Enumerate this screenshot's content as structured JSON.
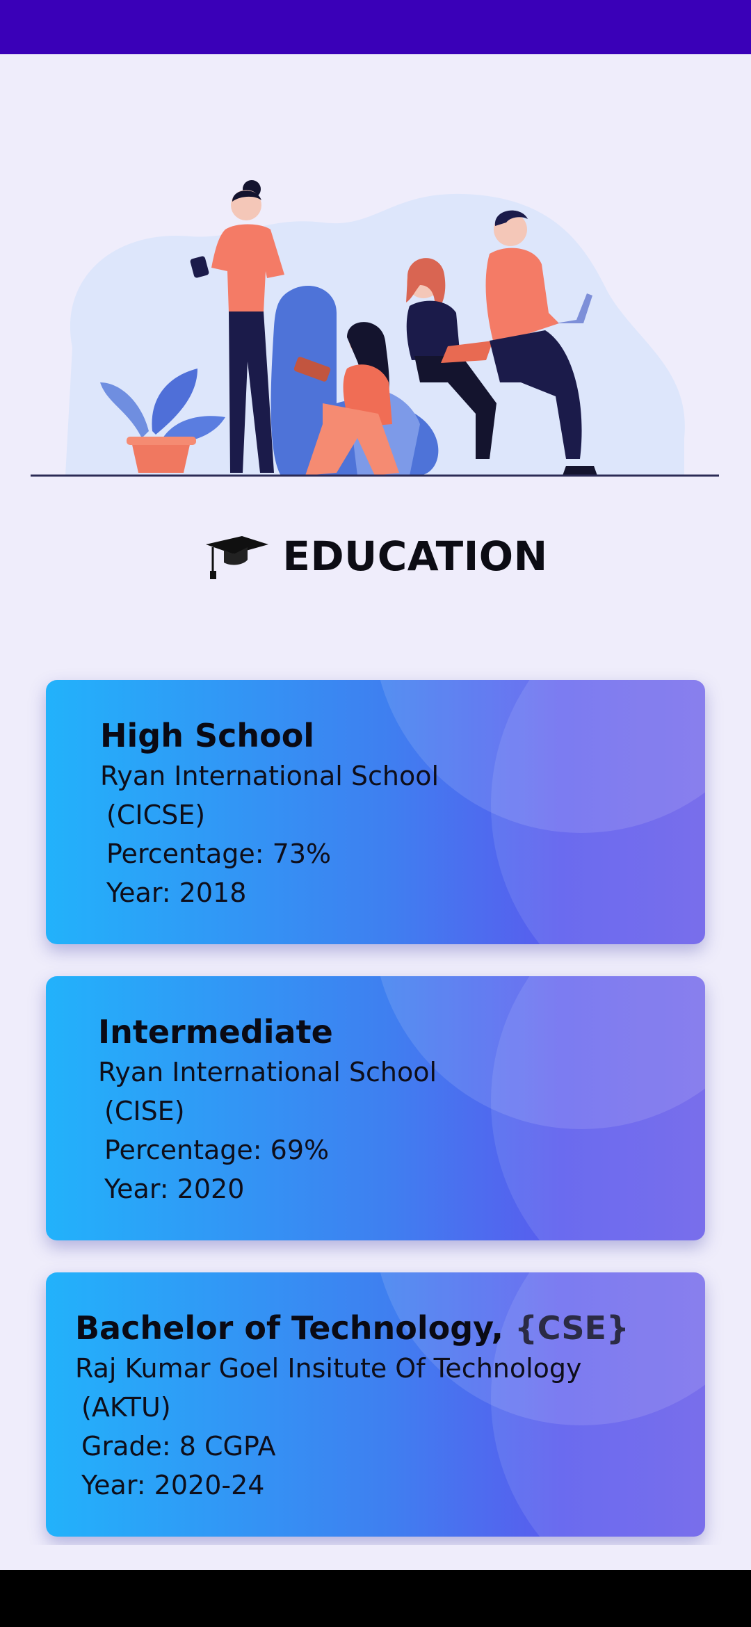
{
  "colors": {
    "status_bar": "#3a00b8",
    "page_background": "#efedfb",
    "card_gradient_start": "#22b2fb",
    "card_gradient_end": "#6a5ee9"
  },
  "hero": {
    "illustration": "people-studying-illustration"
  },
  "section": {
    "icon": "graduation-cap-icon",
    "title": "EDUCATION"
  },
  "education": [
    {
      "title": "High School",
      "institution": "Ryan International School",
      "board": "(CICSE)",
      "score": "Percentage: 73%",
      "year": "Year: 2018"
    },
    {
      "title": "Intermediate",
      "institution": "Ryan International School",
      "board": "(CISE)",
      "score": "Percentage: 69%",
      "year": "Year: 2020"
    },
    {
      "title": "Bachelor of Technology, ",
      "title_accent": "{CSE}",
      "institution": "Raj Kumar Goel Insitute Of Technology",
      "board": "(AKTU)",
      "score": "Grade: 8 CGPA",
      "year": "Year: 2020-24"
    }
  ]
}
